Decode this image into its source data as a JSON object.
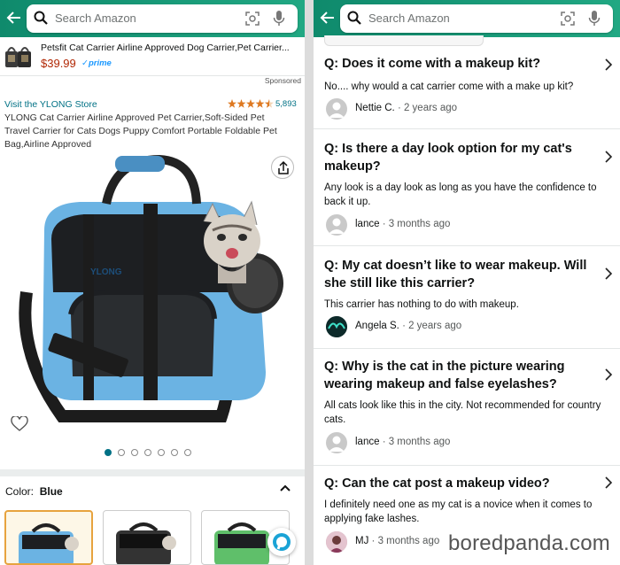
{
  "left": {
    "search_placeholder": "Search Amazon",
    "sponsored_item": {
      "title": "Petsfit Cat Carrier Airline Approved Dog Carrier,Pet Carrier...",
      "price": "$39.99",
      "prime": "✓prime"
    },
    "sponsored_label": "Sponsored",
    "store_link": "Visit the YLONG Store",
    "rating_count": "5,893",
    "rating_stars": 4.5,
    "product_title": "YLONG Cat Carrier Airline Approved Pet Carrier,Soft-Sided Pet Travel Carrier for Cats Dogs Puppy Comfort Portable Foldable Pet Bag,Airline Approved",
    "carousel": {
      "count": 7,
      "active": 0
    },
    "color_label": "Color:",
    "color_value": "Blue"
  },
  "right": {
    "search_placeholder": "Search Amazon",
    "qa": [
      {
        "question": "Q: Does it come with a makeup kit?",
        "answer": "No.... why would a cat carrier come with a make up kit?",
        "author": "Nettie C.",
        "time": " · 2 years ago"
      },
      {
        "question": "Q: Is there a day look option for my cat's makeup?",
        "answer": "Any look is a day look as long as you have the confidence to back it up.",
        "author": "lance",
        "time": " · 3 months ago"
      },
      {
        "question": "Q: My cat doesn’t like to wear makeup. Will she still like this carrier?",
        "answer": "This carrier has nothing to do with makeup.",
        "author": "Angela S.",
        "time": " · 2 years ago"
      },
      {
        "question": "Q: Why is the cat in the picture wearing wearing makeup and false eyelashes?",
        "answer": "All cats look like this in the city. Not recommended for country cats.",
        "author": "lance",
        "time": " · 3 months ago"
      },
      {
        "question": "Q: Can the cat post a makeup video?",
        "answer": "I definitely need one as my cat is a novice when it comes to applying fake lashes.",
        "author": "MJ",
        "time": " · 3 months ago"
      }
    ]
  },
  "watermark": "boredpanda.com",
  "colors": {
    "header": "#148a6f",
    "link": "#007185",
    "price": "#b12704",
    "prime": "#1a98ff",
    "selected_swatch": "#e7a33e"
  }
}
